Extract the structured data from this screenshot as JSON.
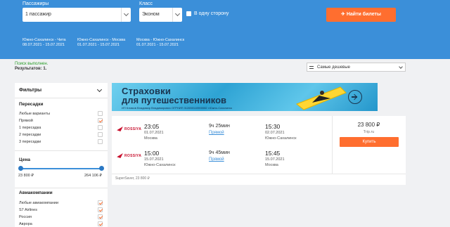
{
  "search": {
    "passengers_label": "Пассажиры",
    "passengers_value": "1 пассажир",
    "class_label": "Класс",
    "class_value": "Эконом",
    "oneway_label": "В одну сторону",
    "find_button": "✈ Найти билеты",
    "recent": [
      {
        "route": "Южно-Сахалинск - Чита",
        "dates": "08.07.2021 - 15.07.2021"
      },
      {
        "route": "Южно-Сахалинск - Москва",
        "dates": "01.07.2021 - 15.07.2021"
      },
      {
        "route": "Москва - Южно-Сахалинск",
        "dates": "01.07.2021 - 15.07.2021"
      }
    ],
    "accent_color": "#3b8fd9",
    "button_color": "#ff6e2f"
  },
  "status": {
    "done": "Поиск выполнен.",
    "results": "Результатов: 1."
  },
  "sort": {
    "value": "Самые дешевые"
  },
  "filters": {
    "title": "Фильтры",
    "stops": {
      "title": "Пересадки",
      "options": [
        {
          "label": "Любые варианты",
          "checked": false
        },
        {
          "label": "Прямой",
          "checked": true
        },
        {
          "label": "1 пересадка",
          "checked": false
        },
        {
          "label": "2 пересадки",
          "checked": false
        },
        {
          "label": "3 пересадки",
          "checked": false
        }
      ]
    },
    "price": {
      "title": "Цена",
      "min": "23 800 ₽",
      "max": "264 106 ₽"
    },
    "airlines": {
      "title": "Авиакомпании",
      "options": [
        {
          "label": "Любые авиакомпании",
          "checked": true
        },
        {
          "label": "S7 Airlines",
          "checked": true
        },
        {
          "label": "Россия",
          "checked": true
        },
        {
          "label": "Аврора",
          "checked": true
        }
      ]
    }
  },
  "banner": {
    "line1": "Страховки",
    "line2": "для путешественников",
    "small": "ИП Климов Владимир Владимирович ОГРНИП 312650110900082 г.Южно-Сахалинск"
  },
  "ticket": {
    "airline_name": "ROSSIYA",
    "outbound": {
      "dep_time": "23:05",
      "dep_date": "01.07.2021",
      "dep_city": "Москва",
      "duration": "9ч 25мин",
      "type": "Прямой",
      "arr_time": "15:30",
      "arr_date": "02.07.2021",
      "arr_city": "Южно-Сахалинск"
    },
    "inbound": {
      "dep_time": "15:00",
      "dep_date": "15.07.2021",
      "dep_city": "Южно-Сахалинск",
      "duration": "9ч 45мин",
      "type": "Прямой",
      "arr_time": "15:45",
      "arr_date": "15.07.2021",
      "arr_city": "Москва"
    },
    "price": "23 800 ₽",
    "seller": "Trip.ru",
    "buy_label": "Купить",
    "footer": "SuperSaver, 23 800 ₽"
  }
}
